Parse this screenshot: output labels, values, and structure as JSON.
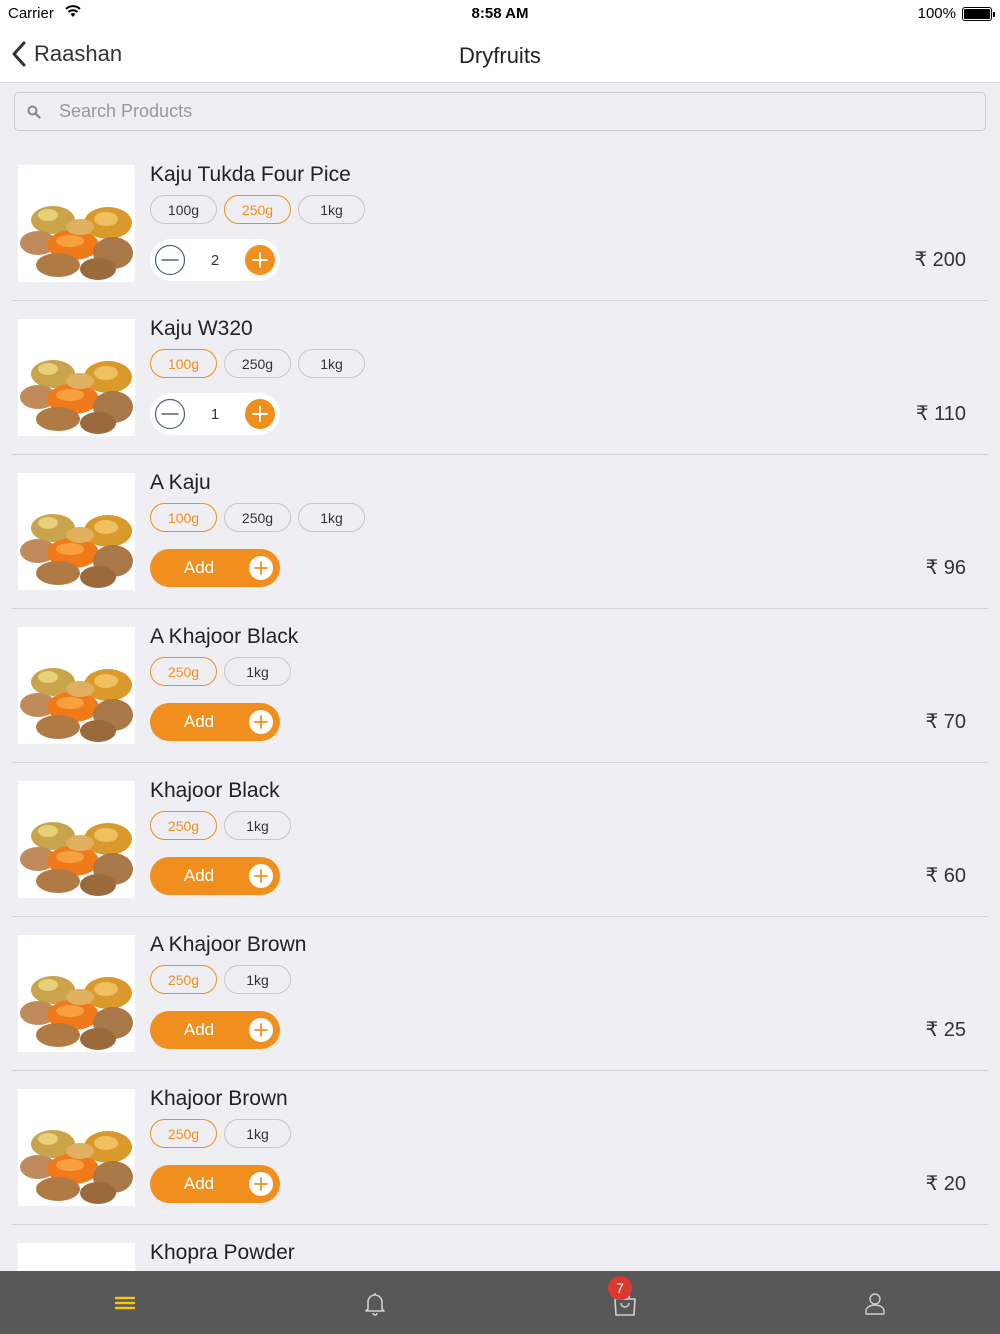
{
  "status_bar": {
    "carrier": "Carrier",
    "time": "8:58 AM",
    "battery": "100%"
  },
  "nav": {
    "back_label": "Raashan",
    "title": "Dryfruits"
  },
  "search": {
    "placeholder": "Search Products"
  },
  "colors": {
    "accent": "#f08f1e",
    "tab_bar": "#585858",
    "badge": "#d93a30",
    "active_tab": "#f5c518"
  },
  "currency_symbol": "₹",
  "add_label": "Add",
  "products": [
    {
      "name": "Kaju Tukda Four Pice",
      "variants": [
        "100g",
        "250g",
        "1kg"
      ],
      "selected": 1,
      "quantity": "2",
      "price": "₹ 200"
    },
    {
      "name": "Kaju W320",
      "variants": [
        "100g",
        "250g",
        "1kg"
      ],
      "selected": 0,
      "quantity": "1",
      "price": "₹ 110"
    },
    {
      "name": "A Kaju",
      "variants": [
        "100g",
        "250g",
        "1kg"
      ],
      "selected": 0,
      "quantity": null,
      "price": "₹ 96"
    },
    {
      "name": "A Khajoor Black",
      "variants": [
        "250g",
        "1kg"
      ],
      "selected": 0,
      "quantity": null,
      "price": "₹ 70"
    },
    {
      "name": "Khajoor Black",
      "variants": [
        "250g",
        "1kg"
      ],
      "selected": 0,
      "quantity": null,
      "price": "₹ 60"
    },
    {
      "name": "A Khajoor Brown",
      "variants": [
        "250g",
        "1kg"
      ],
      "selected": 0,
      "quantity": null,
      "price": "₹ 25"
    },
    {
      "name": "Khajoor Brown",
      "variants": [
        "250g",
        "1kg"
      ],
      "selected": 0,
      "quantity": null,
      "price": "₹ 20"
    },
    {
      "name": "Khopra Powder",
      "variants": [],
      "selected": 0,
      "quantity": null,
      "price": ""
    }
  ],
  "tabs": [
    {
      "icon": "menu-icon",
      "active": true
    },
    {
      "icon": "bell-icon",
      "active": false
    },
    {
      "icon": "shopping-bag-icon",
      "active": false
    },
    {
      "icon": "user-icon",
      "active": false
    }
  ],
  "cart_badge": "7"
}
